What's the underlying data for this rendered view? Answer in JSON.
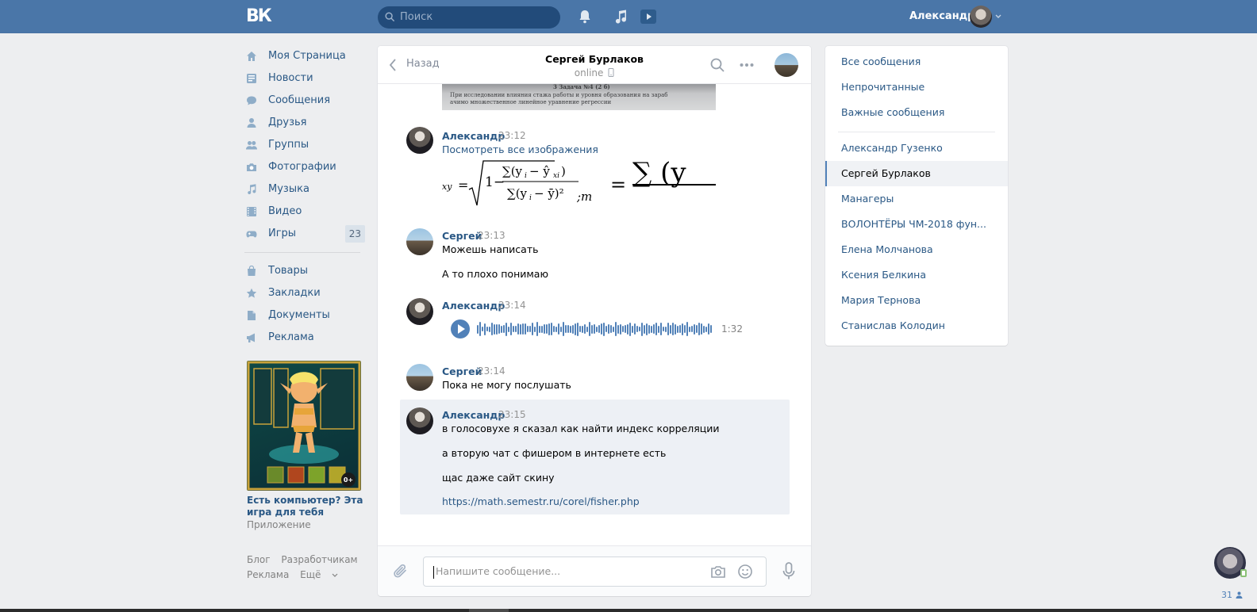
{
  "header": {
    "logo": "ВК",
    "search_placeholder": "Поиск",
    "user_name": "Александр"
  },
  "leftnav": {
    "items": [
      {
        "label": "Моя Страница",
        "icon": "home-icon"
      },
      {
        "label": "Новости",
        "icon": "news-icon"
      },
      {
        "label": "Сообщения",
        "icon": "messages-icon"
      },
      {
        "label": "Друзья",
        "icon": "friends-icon"
      },
      {
        "label": "Группы",
        "icon": "groups-icon"
      },
      {
        "label": "Фотографии",
        "icon": "camera-icon"
      },
      {
        "label": "Музыка",
        "icon": "music-icon"
      },
      {
        "label": "Видео",
        "icon": "video-icon"
      },
      {
        "label": "Игры",
        "icon": "gamepad-icon",
        "badge": "23"
      }
    ],
    "items2": [
      {
        "label": "Товары",
        "icon": "bag-icon"
      },
      {
        "label": "Закладки",
        "icon": "star-icon"
      },
      {
        "label": "Документы",
        "icon": "document-icon"
      },
      {
        "label": "Реклама",
        "icon": "megaphone-icon"
      }
    ],
    "ad": {
      "title": "Есть компьютер? Эта игра для тебя",
      "subtitle": "Приложение",
      "age": "0+"
    },
    "footer": {
      "blog": "Блог",
      "developers": "Разработчикам",
      "ads": "Реклама",
      "more": "Ещё"
    }
  },
  "chat": {
    "back_label": "Назад",
    "peer_name": "Сергей Бурлаков",
    "peer_status": "online",
    "photo_caption_1": "При исследовании влияния стажа работы и уровня образования на зараб",
    "photo_caption_2": "ачимо множественное линейное уравнение регрессии",
    "photo_caption_3": "3 Задача №4 (2 б)",
    "messages": [
      {
        "author": "Александр",
        "time": "23:12",
        "link": "Посмотреть все изображения"
      },
      {
        "author": "Сергей",
        "time": "23:13",
        "lines": [
          "Можешь написать",
          "А то плохо понимаю"
        ]
      },
      {
        "author": "Александр",
        "time": "23:14",
        "voice_duration": "1:32"
      },
      {
        "author": "Сергей",
        "time": "23:14",
        "lines": [
          "Пока не могу послушать"
        ]
      },
      {
        "author": "Александр",
        "time": "23:15",
        "lines": [
          "в голосовухе я сказал как найти индекс корреляции",
          "а вторую чат с фишером в интернете есть",
          "щас даже сайт скину"
        ],
        "url": "https://math.semestr.ru/corel/fisher.php"
      }
    ],
    "compose_placeholder": "Напишите сообщение..."
  },
  "rightpanel": {
    "folders": [
      "Все сообщения",
      "Непрочитанные",
      "Важные сообщения"
    ],
    "dialogs": [
      "Александр Гузенко",
      "Сергей Бурлаков",
      "Манагеры",
      "ВОЛОНТЁРЫ ЧМ-2018 фун...",
      "Елена Молчанова",
      "Ксения Белкина",
      "Мария Тернова",
      "Станислав Колодин"
    ],
    "active_dialog": "Сергей Бурлаков"
  },
  "widget": {
    "online_count": "31"
  },
  "colors": {
    "brand": "#4a76a8",
    "link": "#2a5885",
    "background": "#edeef0"
  }
}
